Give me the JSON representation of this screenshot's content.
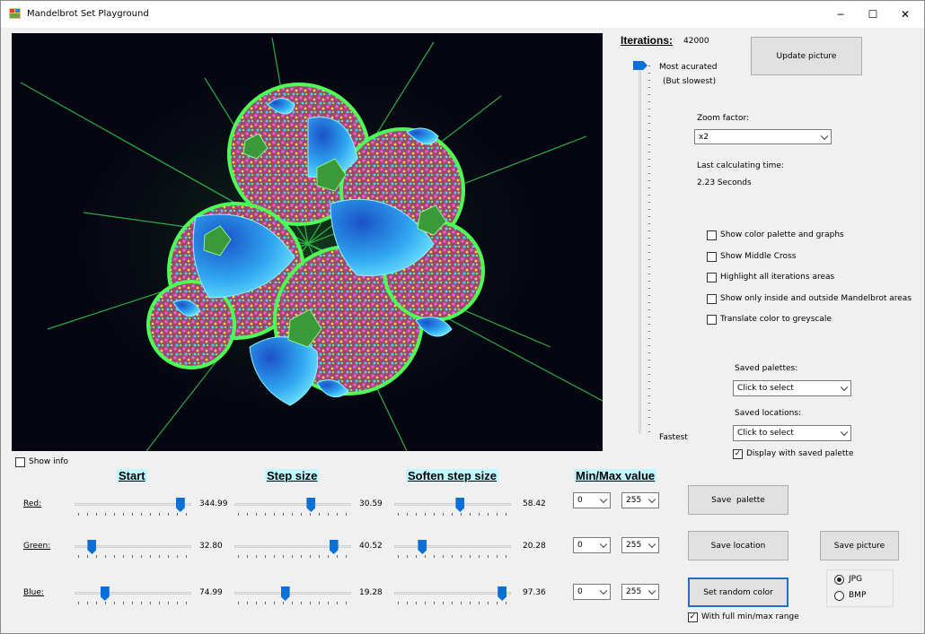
{
  "window": {
    "title": "Mandelbrot Set Playground",
    "controls": {
      "minimize": "─",
      "maximize": "☐",
      "close": "✕"
    }
  },
  "iterations": {
    "label": "Iterations:",
    "value": "42000",
    "most_label": "Most acurated",
    "most_sub": "(But slowest)",
    "fastest_label": "Fastest"
  },
  "buttons": {
    "update": "Update picture",
    "save_palette": "Save  palette",
    "save_location": "Save location",
    "save_picture": "Save picture",
    "random_color": "Set random color"
  },
  "zoom": {
    "label": "Zoom factor:",
    "value": "x2"
  },
  "calc": {
    "label": "Last calculating time:",
    "value": "2.23 Seconds"
  },
  "options": [
    {
      "label": "Show color palette and graphs",
      "checked": false
    },
    {
      "label": "Show Middle Cross",
      "checked": false
    },
    {
      "label": "Highlight all iterations areas",
      "checked": false
    },
    {
      "label": "Show only inside and outside Mandelbrot areas",
      "checked": false
    },
    {
      "label": "Translate color to greyscale",
      "checked": false
    }
  ],
  "saved_palettes": {
    "label": "Saved palettes:",
    "value": "Click to select"
  },
  "saved_locations": {
    "label": "Saved locations:",
    "value": "Click to select"
  },
  "display_saved_palette": {
    "label": "Display with saved palette",
    "checked": true
  },
  "show_info": {
    "label": "Show info",
    "checked": false
  },
  "headers": {
    "start": "Start",
    "step": "Step size",
    "soften": "Soften step size",
    "minmax": "Min/Max value"
  },
  "channels": [
    {
      "name": "Red:",
      "start": "344.99",
      "step": "30.59",
      "soften": "58.42",
      "min": "0",
      "max": "255",
      "start_frac": 0.94,
      "step_frac": 0.67,
      "soften_frac": 0.57
    },
    {
      "name": "Green:",
      "start": "32.80",
      "step": "40.52",
      "soften": "20.28",
      "min": "0",
      "max": "255",
      "start_frac": 0.12,
      "step_frac": 0.88,
      "soften_frac": 0.22
    },
    {
      "name": "Blue:",
      "start": "74.99",
      "step": "19.28",
      "soften": "97.36",
      "min": "0",
      "max": "255",
      "start_frac": 0.24,
      "step_frac": 0.43,
      "soften_frac": 0.96
    }
  ],
  "format": {
    "jpg": {
      "label": "JPG",
      "selected": true
    },
    "bmp": {
      "label": "BMP",
      "selected": false
    }
  },
  "full_range": {
    "label": "With full min/max range",
    "checked": true
  },
  "colors": {
    "accent": "#0a6fd6",
    "header_bg": "#bff7ff"
  }
}
